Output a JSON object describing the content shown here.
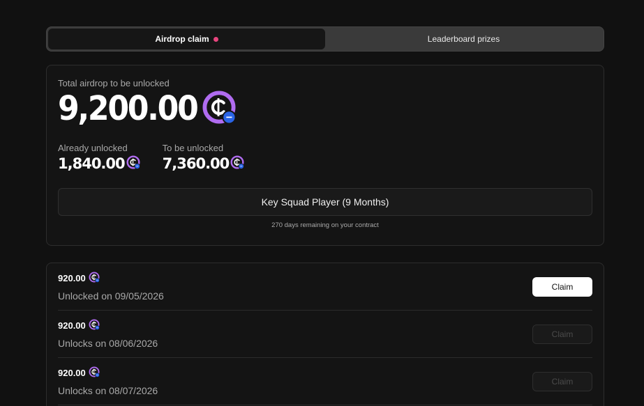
{
  "tabs": [
    {
      "label": "Airdrop claim",
      "active": true
    },
    {
      "label": "Leaderboard prizes",
      "active": false
    }
  ],
  "colors": {
    "notification_dot": "#e8457e",
    "coin_ring": "#b06cf0",
    "coin_badge": "#2a64e6"
  },
  "summary": {
    "total_label": "Total airdrop to be unlocked",
    "total_amount": "9,200.00",
    "unlocked_label": "Already unlocked",
    "unlocked_amount": "1,840.00",
    "remaining_label": "To be unlocked",
    "remaining_amount": "7,360.00",
    "contract_label": "Key Squad Player (9 Months)",
    "contract_note": "270 days remaining on your contract"
  },
  "unlocks": [
    {
      "amount": "920.00",
      "date_text": "Unlocked on 09/05/2026",
      "claim_label": "Claim",
      "enabled": true
    },
    {
      "amount": "920.00",
      "date_text": "Unlocks on 08/06/2026",
      "claim_label": "Claim",
      "enabled": false
    },
    {
      "amount": "920.00",
      "date_text": "Unlocks on 08/07/2026",
      "claim_label": "Claim",
      "enabled": false
    }
  ],
  "icons": {
    "token": "coin-icon"
  }
}
